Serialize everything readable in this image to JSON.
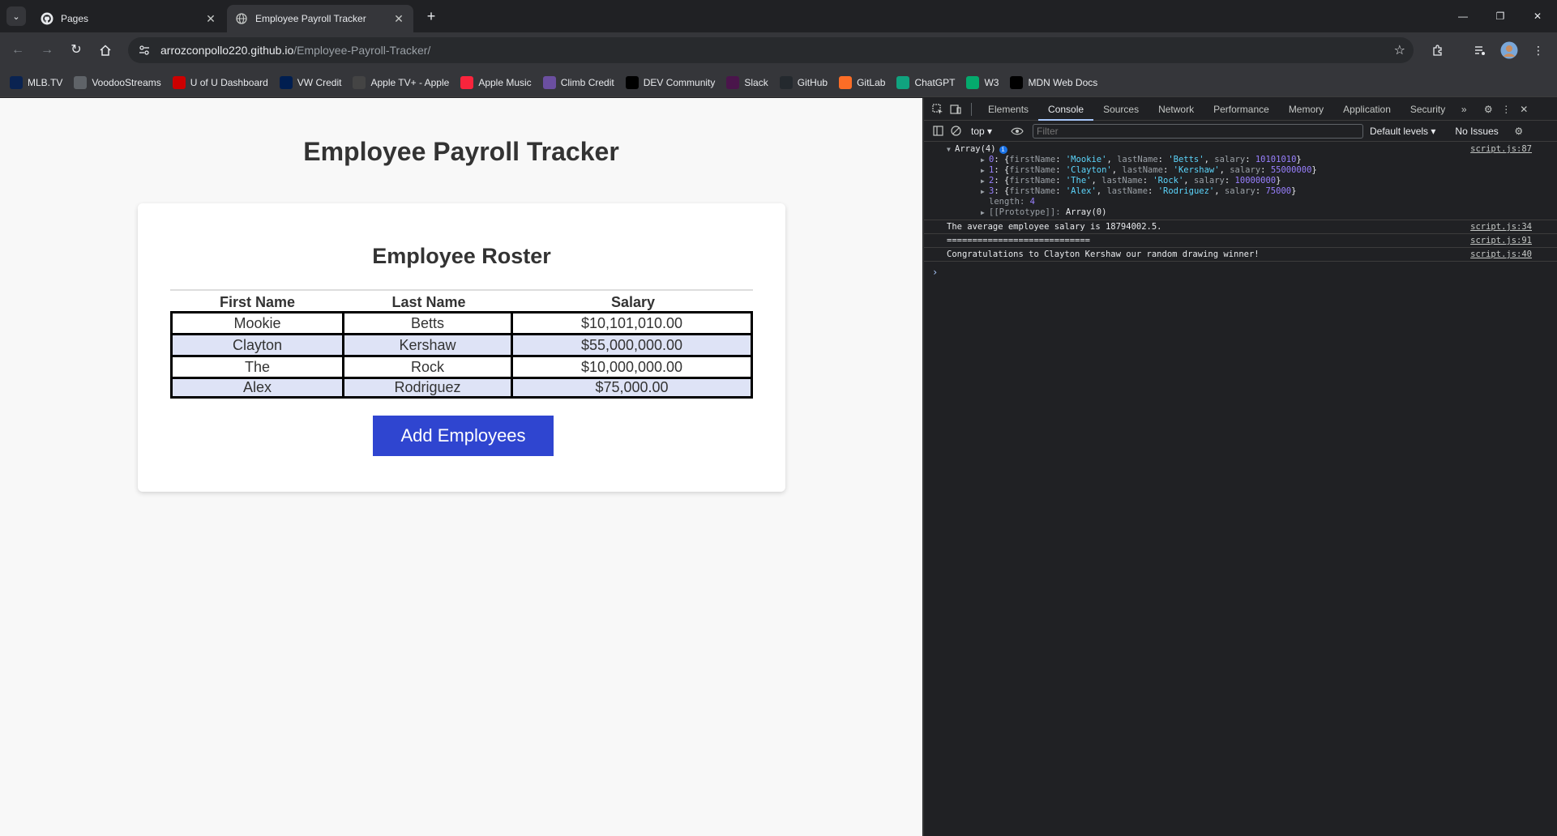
{
  "browser": {
    "tabs": [
      {
        "label": "Pages",
        "active": false
      },
      {
        "label": "Employee Payroll Tracker",
        "active": true
      }
    ],
    "url_host": "arrozconpollo220.github.io",
    "url_path": "/Employee-Payroll-Tracker/",
    "bookmarks": [
      {
        "label": "MLB.TV",
        "icon": "mlb-icon",
        "color": "#0a2351"
      },
      {
        "label": "VoodooStreams",
        "icon": "globe-icon",
        "color": "#5f6368"
      },
      {
        "label": "U of U Dashboard",
        "icon": "utah-icon",
        "color": "#cc0000"
      },
      {
        "label": "VW Credit",
        "icon": "vw-icon",
        "color": "#001e50"
      },
      {
        "label": "Apple TV+ - Apple",
        "icon": "apple-icon",
        "color": "#444"
      },
      {
        "label": "Apple Music",
        "icon": "music-icon",
        "color": "#fa243c"
      },
      {
        "label": "Climb Credit",
        "icon": "climb-icon",
        "color": "#6b4fa0"
      },
      {
        "label": "DEV Community",
        "icon": "dev-icon",
        "color": "#000"
      },
      {
        "label": "Slack",
        "icon": "slack-icon",
        "color": "#4a154b"
      },
      {
        "label": "GitHub",
        "icon": "github-icon",
        "color": "#24292e"
      },
      {
        "label": "GitLab",
        "icon": "gitlab-icon",
        "color": "#fc6d26"
      },
      {
        "label": "ChatGPT",
        "icon": "chatgpt-icon",
        "color": "#10a37f"
      },
      {
        "label": "W3",
        "icon": "w3-icon",
        "color": "#04aa6d"
      },
      {
        "label": "MDN Web Docs",
        "icon": "mdn-icon",
        "color": "#000"
      }
    ]
  },
  "page": {
    "title": "Employee Payroll Tracker",
    "roster_title": "Employee Roster",
    "columns": [
      "First Name",
      "Last Name",
      "Salary"
    ],
    "rows": [
      [
        "Mookie",
        "Betts",
        "$10,101,010.00"
      ],
      [
        "Clayton",
        "Kershaw",
        "$55,000,000.00"
      ],
      [
        "The",
        "Rock",
        "$10,000,000.00"
      ],
      [
        "Alex",
        "Rodriguez",
        "$75,000.00"
      ]
    ],
    "add_button": "Add Employees",
    "accent_color": "#2f45d0"
  },
  "devtools": {
    "tabs": [
      "Elements",
      "Console",
      "Sources",
      "Network",
      "Performance",
      "Memory",
      "Application",
      "Security"
    ],
    "active_tab": "Console",
    "context": "top",
    "filter_placeholder": "Filter",
    "levels": "Default levels",
    "issues": "No Issues",
    "console": {
      "array_header": "Array(4)",
      "array_items": [
        {
          "index": "0",
          "firstName": "'Mookie'",
          "lastName": "'Betts'",
          "salary": "10101010"
        },
        {
          "index": "1",
          "firstName": "'Clayton'",
          "lastName": "'Kershaw'",
          "salary": "55000000"
        },
        {
          "index": "2",
          "firstName": "'The'",
          "lastName": "'Rock'",
          "salary": "10000000"
        },
        {
          "index": "3",
          "firstName": "'Alex'",
          "lastName": "'Rodriguez'",
          "salary": "75000"
        }
      ],
      "length_label": "length",
      "length_value": "4",
      "prototype_label": "[[Prototype]]",
      "prototype_value": "Array(0)",
      "array_source": "script.js:87",
      "messages": [
        {
          "text": "The average employee salary is 18794002.5.",
          "source": "script.js:34"
        },
        {
          "text": "============================",
          "source": "script.js:91"
        },
        {
          "text": "Congratulations to Clayton Kershaw our random drawing winner!",
          "source": "script.js:40"
        }
      ]
    }
  }
}
